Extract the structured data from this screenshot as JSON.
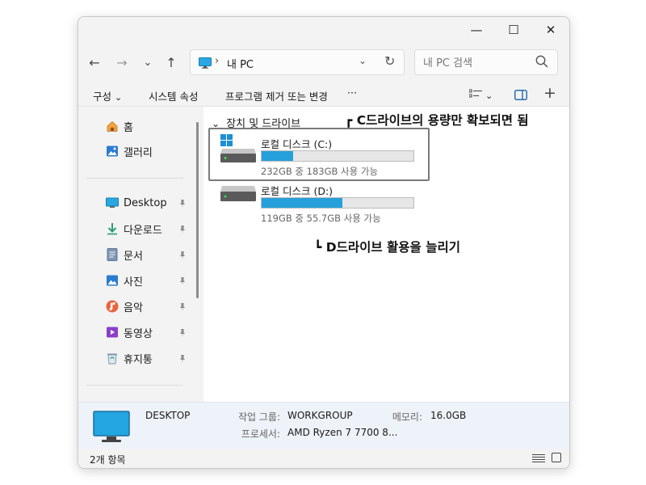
{
  "window": {
    "minimize_glyph": "—",
    "maximize_glyph": "☐",
    "close_glyph": "✕"
  },
  "nav": {
    "back_glyph": "←",
    "forward_glyph": "→",
    "recent_glyph": "⌄",
    "up_glyph": "↑",
    "address": {
      "separator": "›",
      "path": "내 PC",
      "dropdown_glyph": "⌄",
      "refresh_glyph": "↻"
    },
    "search": {
      "placeholder": "내 PC 검색"
    }
  },
  "toolbar": {
    "organize": "구성",
    "organize_chevron": "⌄",
    "system_properties": "시스템 속성",
    "uninstall": "프로그램 제거 또는 변경",
    "more": "···",
    "view_chevron": "⌄",
    "add": "+"
  },
  "sidebar": {
    "top_items": [
      {
        "label": "홈",
        "icon": "home-icon"
      },
      {
        "label": "갤러리",
        "icon": "gallery-icon"
      }
    ],
    "pinned_items": [
      {
        "label": "Desktop",
        "icon": "desktop-icon"
      },
      {
        "label": "다운로드",
        "icon": "download-icon"
      },
      {
        "label": "문서",
        "icon": "document-icon"
      },
      {
        "label": "사진",
        "icon": "pictures-icon"
      },
      {
        "label": "음악",
        "icon": "music-icon"
      },
      {
        "label": "동영상",
        "icon": "video-icon"
      },
      {
        "label": "휴지통",
        "icon": "recycle-bin-icon"
      }
    ],
    "pin_glyph": "📌"
  },
  "content": {
    "group_label": "장치 및 드라이브",
    "group_chevron": "⌄",
    "drives": [
      {
        "name": "로컬 디스크 (C:)",
        "free_text": "232GB 중 183GB 사용 가능",
        "used_fraction": 0.21,
        "bar_color": "#26a0da"
      },
      {
        "name": "로컬 디스크 (D:)",
        "free_text": "119GB 중 55.7GB 사용 가능",
        "used_fraction": 0.53,
        "bar_color": "#26a0da"
      }
    ],
    "annotations": {
      "c_note": "┏ C드라이브의 용량만 확보되면 됨",
      "d_note": "┗ D드라이브 활용을 늘리기"
    }
  },
  "details": {
    "pc_name": "DESKTOP",
    "workgroup_label": "작업 그룹:",
    "workgroup_value": "WORKGROUP",
    "memory_label": "메모리:",
    "memory_value": "16.0GB",
    "processor_label": "프로세서:",
    "processor_value": "AMD Ryzen 7 7700 8..."
  },
  "status": {
    "item_count": "2개 항목"
  },
  "colors": {
    "accent": "#26a0da",
    "window_bg": "#f3f3f3",
    "details_bg": "#eef2f9"
  }
}
